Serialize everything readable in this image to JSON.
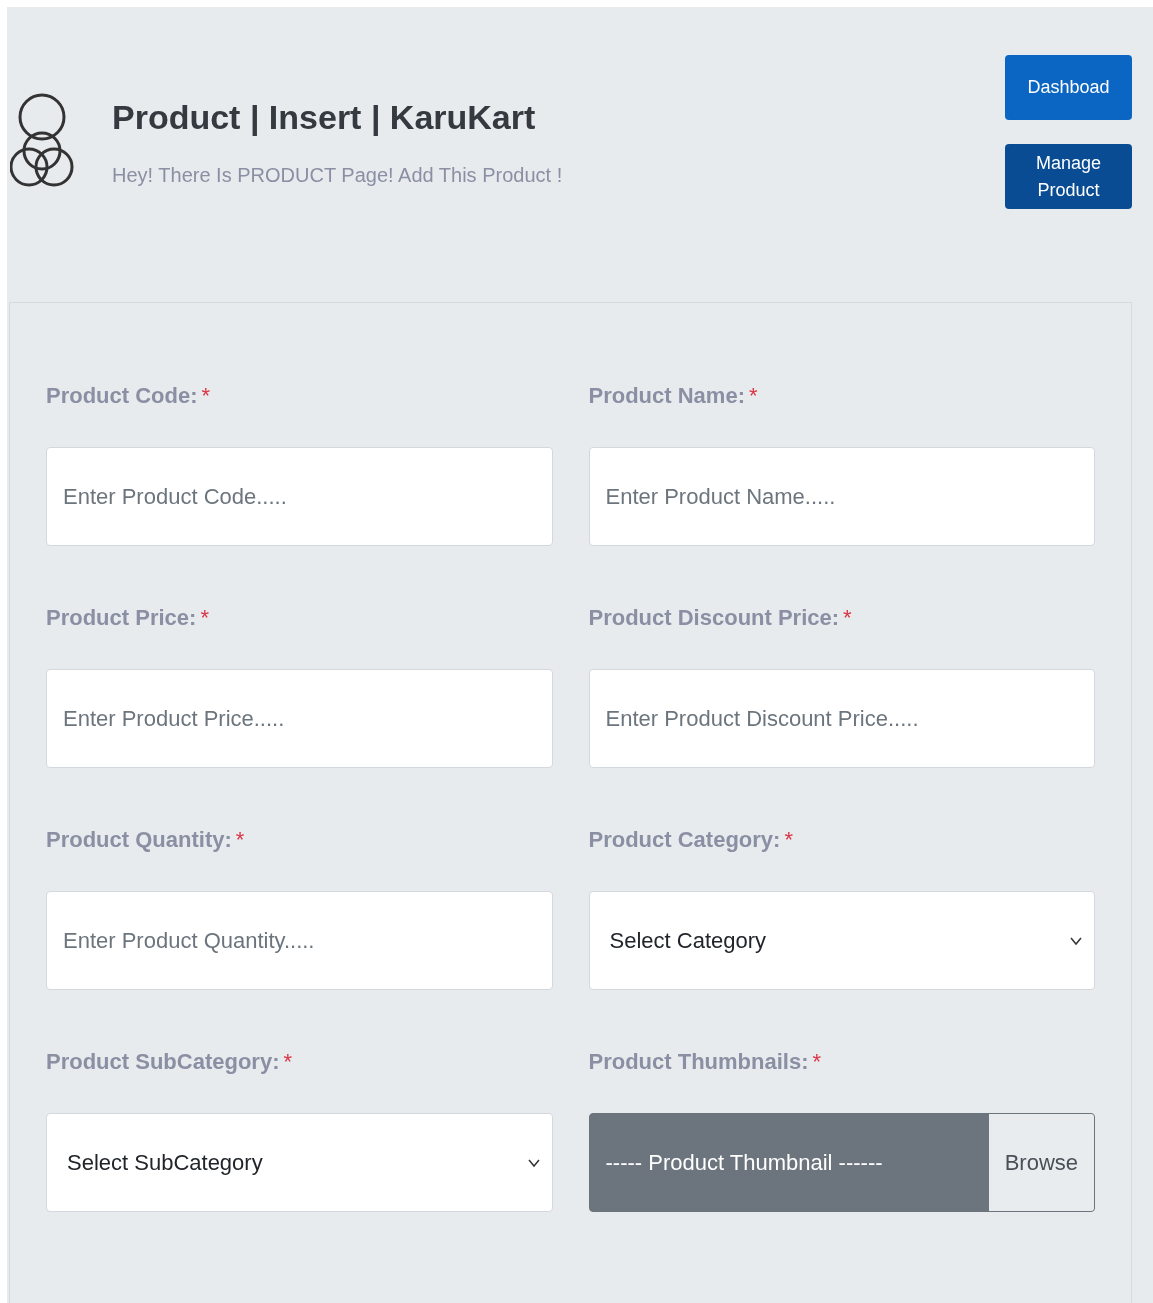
{
  "header": {
    "title": "Product | Insert | KaruKart",
    "subtitle": "Hey! There Is PRODUCT Page! Add This Product !"
  },
  "buttons": [
    {
      "label": "Dashboad",
      "kind": "primary"
    },
    {
      "label": "Manage Product",
      "kind": "dark"
    }
  ],
  "fields": [
    {
      "kind": "text",
      "label": "Product Code:",
      "required_mark": "*",
      "placeholder": "Enter Product Code....."
    },
    {
      "kind": "text",
      "label": "Product Name:",
      "required_mark": "*",
      "placeholder": "Enter Product Name....."
    },
    {
      "kind": "text",
      "label": "Product Price:",
      "required_mark": "*",
      "placeholder": "Enter Product Price....."
    },
    {
      "kind": "text",
      "label": "Product Discount Price:",
      "required_mark": "*",
      "placeholder": "Enter Product Discount Price....."
    },
    {
      "kind": "text",
      "label": "Product Quantity:",
      "required_mark": "*",
      "placeholder": "Enter Product Quantity....."
    },
    {
      "kind": "select",
      "label": "Product Category:",
      "required_mark": "*",
      "value": "Select Category"
    },
    {
      "kind": "select",
      "label": "Product SubCategory:",
      "required_mark": "*",
      "value": "Select SubCategory"
    },
    {
      "kind": "file",
      "label": "Product Thumbnails:",
      "required_mark": "*",
      "value": "----- Product Thumbnail ------",
      "button": "Browse"
    }
  ]
}
